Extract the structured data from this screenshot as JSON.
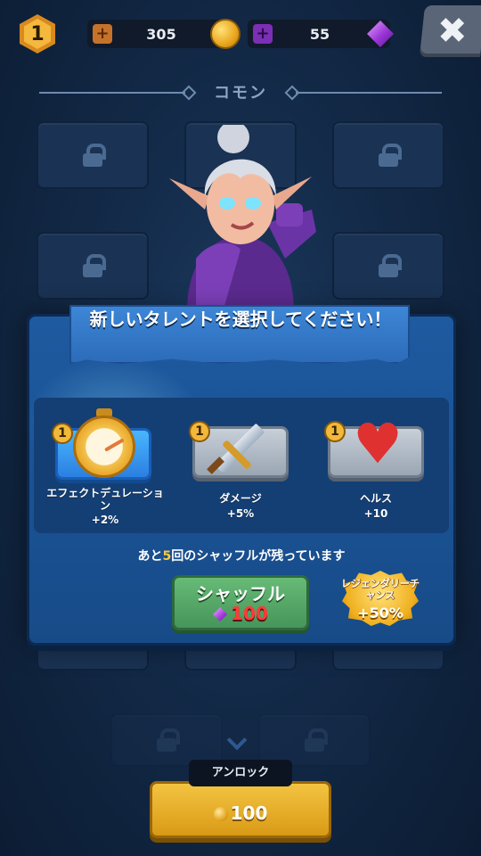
{
  "header": {
    "level": "1",
    "gold": "305",
    "gems": "55",
    "close_symbol": "✖"
  },
  "tier_title": "コモン",
  "dialog": {
    "title": "新しいタレントを選択してください！",
    "talents": [
      {
        "rank": "1",
        "name": "エフェクトデュレーション",
        "bonus": "+2%",
        "icon": "stopwatch-icon",
        "selected": true
      },
      {
        "rank": "1",
        "name": "ダメージ",
        "bonus": "+5%",
        "icon": "sword-icon",
        "selected": false
      },
      {
        "rank": "1",
        "name": "ヘルス",
        "bonus": "+10",
        "icon": "heart-icon",
        "selected": false
      }
    ],
    "shuffle_note_prefix": "あと",
    "shuffle_remaining": "5",
    "shuffle_note_suffix": "回のシャッフルが残っています",
    "shuffle_label": "シャッフル",
    "shuffle_cost": "100",
    "legend_label": "レジェンダリーチャンス",
    "legend_bonus": "+50%"
  },
  "unlock": {
    "label": "アンロック",
    "cost": "100"
  },
  "colors": {
    "background": "#132a48",
    "dialog": "#1e5aa0",
    "shuffle_button": "#46955a",
    "unlock_button": "#d99a16",
    "gem_cost": "#ff3b3b"
  }
}
